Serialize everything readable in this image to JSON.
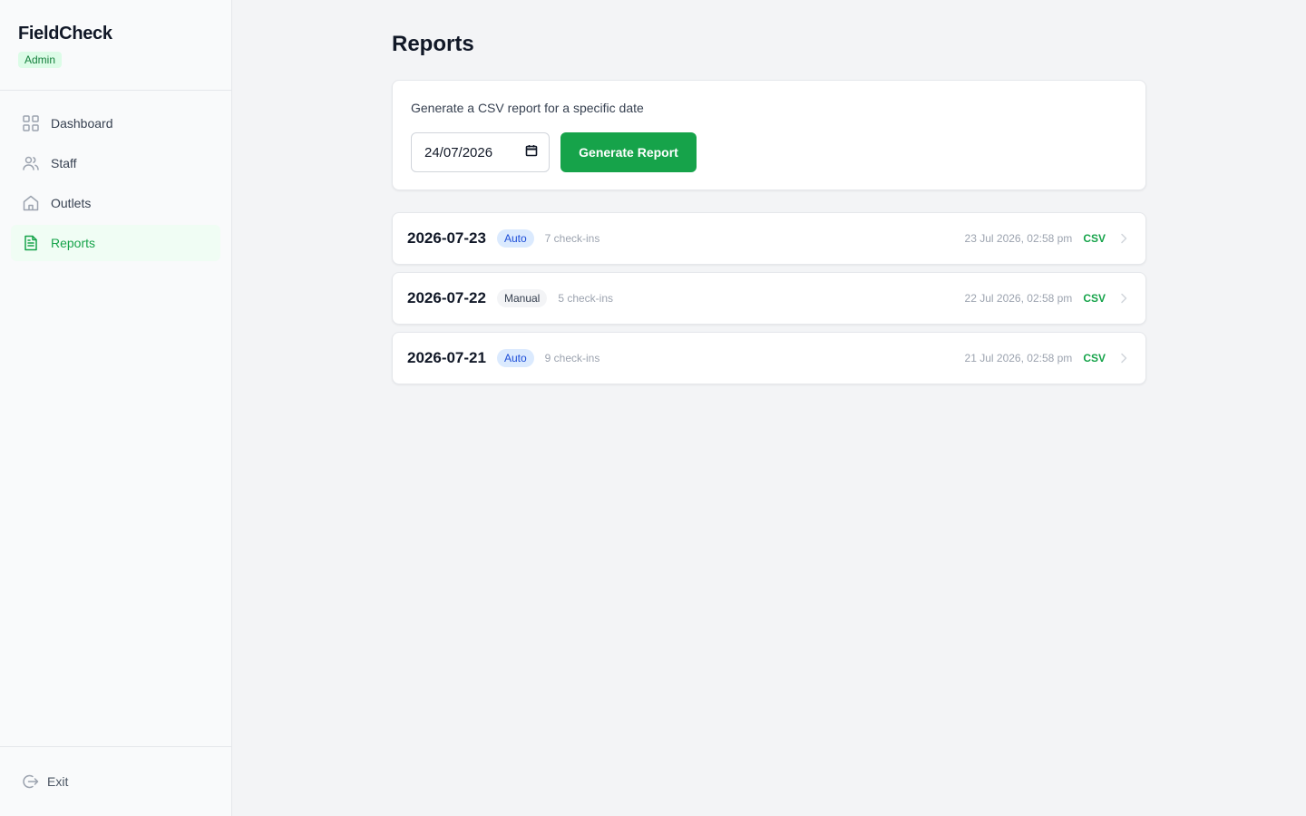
{
  "sidebar": {
    "brand": "FieldCheck",
    "role_badge": "Admin",
    "items": [
      {
        "label": "Dashboard",
        "icon": "grid-icon",
        "active": false
      },
      {
        "label": "Staff",
        "icon": "users-icon",
        "active": false
      },
      {
        "label": "Outlets",
        "icon": "store-icon",
        "active": false
      },
      {
        "label": "Reports",
        "icon": "file-text-icon",
        "active": true
      }
    ],
    "exit_label": "Exit"
  },
  "main": {
    "title": "Reports",
    "generator": {
      "label": "Generate a CSV report for a specific date",
      "date_value": "24/07/2026",
      "button_label": "Generate Report"
    },
    "reports": [
      {
        "date": "2026-07-23",
        "type": "Auto",
        "checkins": "7 check-ins",
        "created": "23 Jul 2026, 02:58 pm",
        "download": "CSV"
      },
      {
        "date": "2026-07-22",
        "type": "Manual",
        "checkins": "5 check-ins",
        "created": "22 Jul 2026, 02:58 pm",
        "download": "CSV"
      },
      {
        "date": "2026-07-21",
        "type": "Auto",
        "checkins": "9 check-ins",
        "created": "21 Jul 2026, 02:58 pm",
        "download": "CSV"
      }
    ]
  },
  "colors": {
    "accent": "#16a34a",
    "auto_badge_bg": "#dbeafe",
    "auto_badge_text": "#1d4ed8",
    "manual_badge_bg": "#f3f4f6"
  }
}
